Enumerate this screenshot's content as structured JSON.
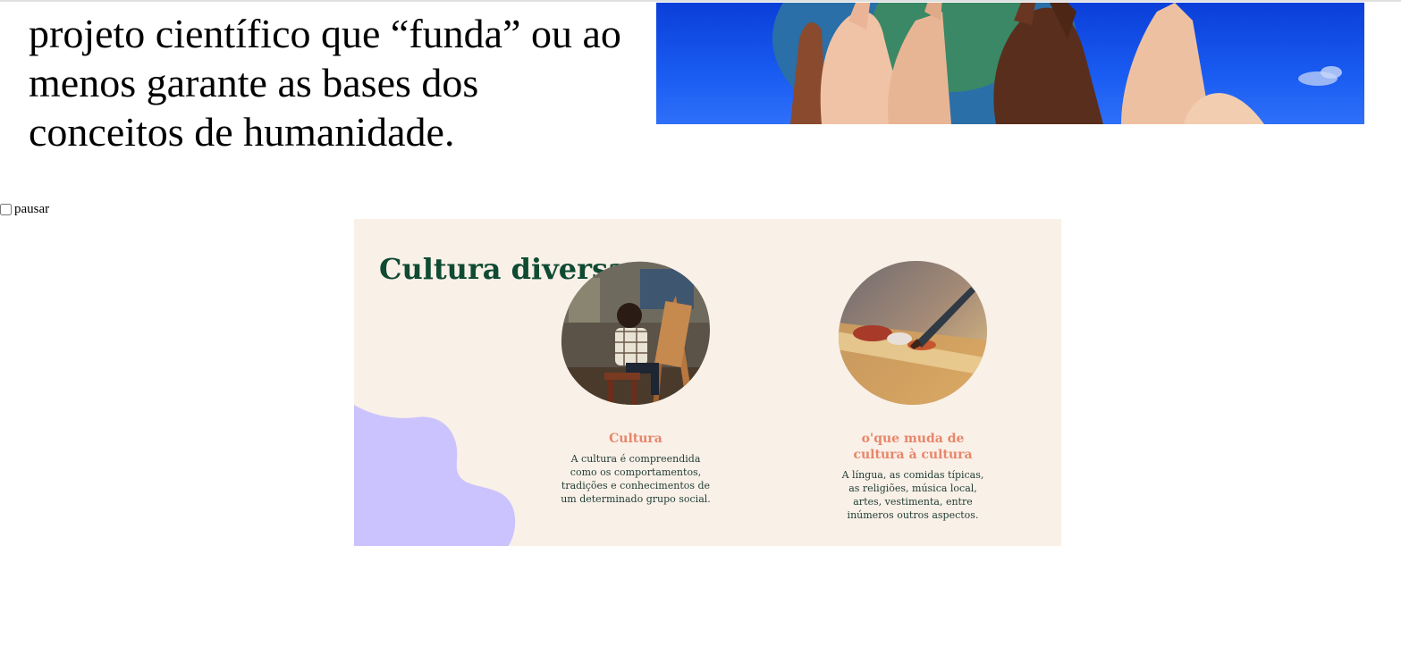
{
  "intro": {
    "text": "projeto científico que “funda” ou ao menos garante as bases dos conceitos de humanidade."
  },
  "hero_image": {
    "description_icon": "hands-on-globe-image"
  },
  "pause": {
    "label": "pausar",
    "checked": false
  },
  "slide": {
    "title": "Cultura diversas",
    "colors": {
      "background": "#f9f0e8",
      "title": "#0f4a32",
      "card_title": "#e8866a",
      "blob": "#cbc3fd"
    },
    "cards": [
      {
        "image_icon": "painter-at-easel-image",
        "title": "Cultura",
        "text": "A cultura é compreendida como os comportamentos, tradições e conhecimentos de um determinado grupo social."
      },
      {
        "image_icon": "paintbrush-palette-image",
        "title": "o'que muda de cultura à cultura",
        "text": "A língua, as comidas típicas, as religiões, música local, artes, vestimenta, entre inúmeros outros aspectos."
      }
    ]
  }
}
